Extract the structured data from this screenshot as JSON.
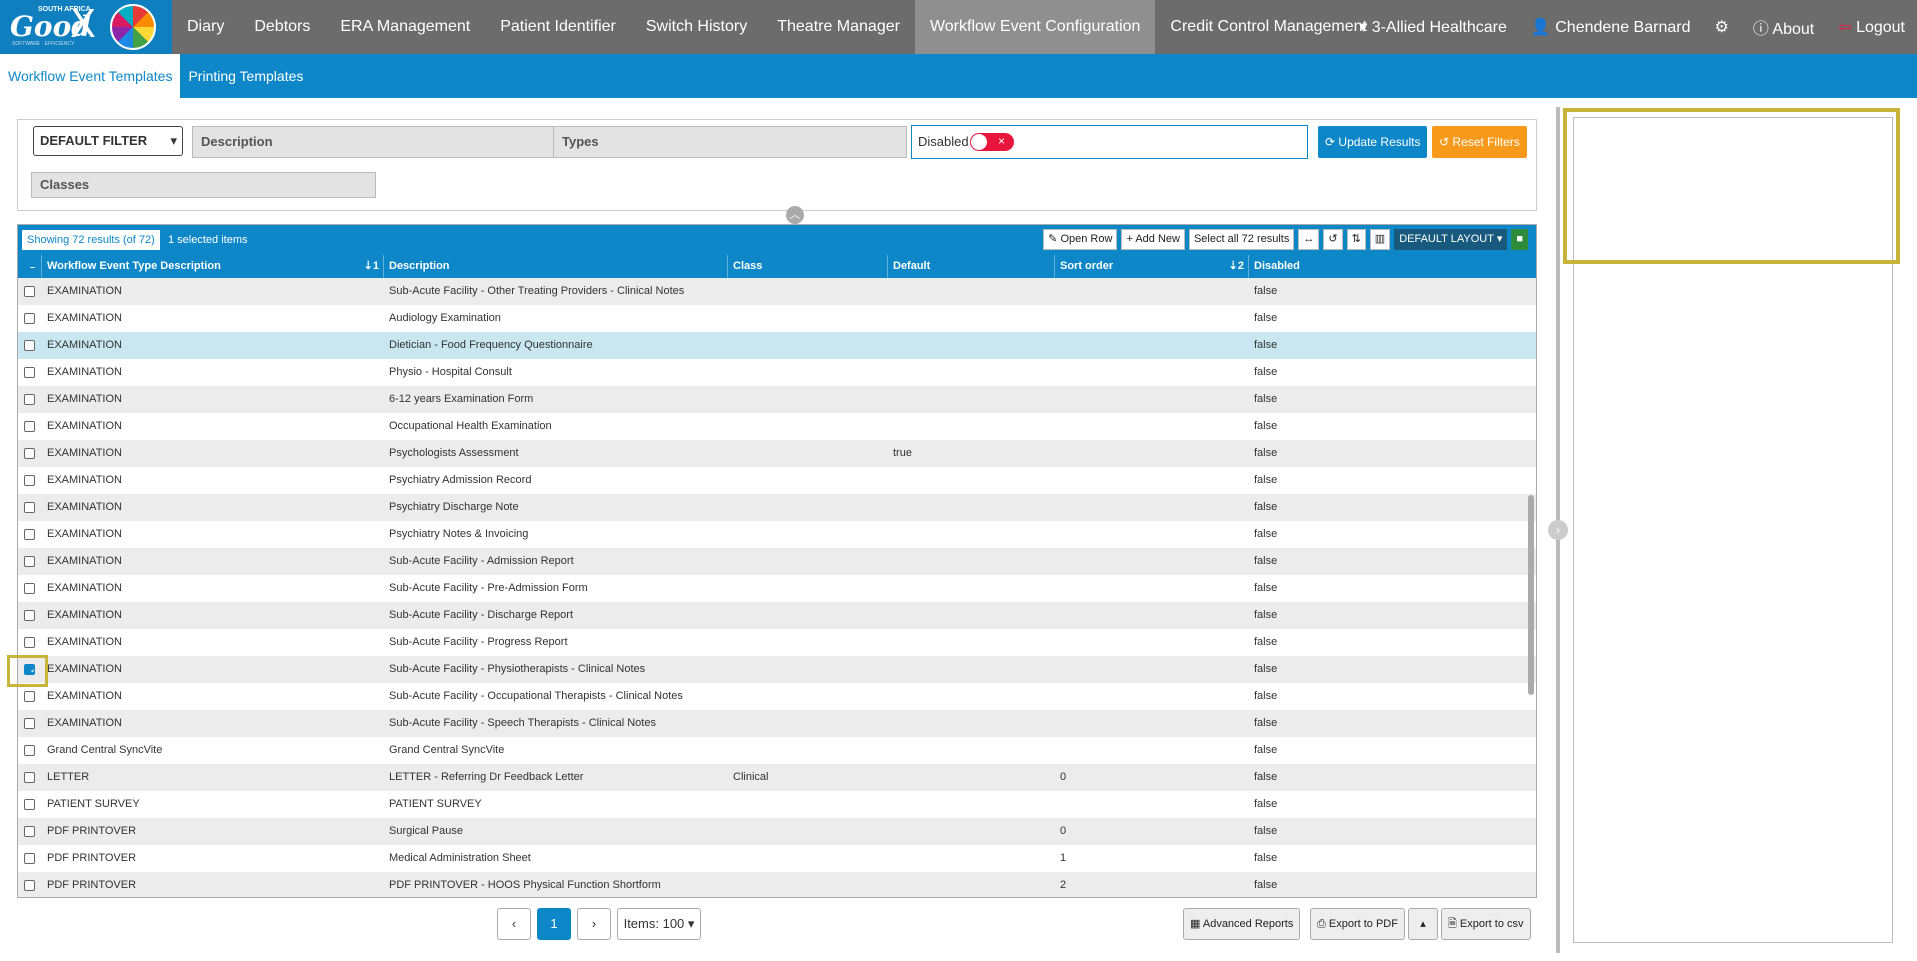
{
  "brand": {
    "good": "Good",
    "sa": "SOUTH AFRICA",
    "x": "X",
    "tagline": "SOFTWARE · EFFICIENCY"
  },
  "nav": [
    "Diary",
    "Debtors",
    "ERA Management",
    "Patient Identifier",
    "Switch History",
    "Theatre Manager",
    "Workflow Event Configuration",
    "Credit Control Management"
  ],
  "nav_active": "Workflow Event Configuration",
  "rightnav": {
    "practice": "3-Allied Healthcare",
    "user": "Chendene Barnard",
    "about": "About",
    "logout": "Logout"
  },
  "subnav": [
    "Workflow Event Templates",
    "Printing Templates"
  ],
  "filters": {
    "default_filter": "DEFAULT FILTER",
    "description": "Description",
    "types": "Types",
    "disabled": "Disabled",
    "classes": "Classes",
    "update": "Update Results",
    "reset": "Reset Filters"
  },
  "grid": {
    "count": "Showing 72 results (of 72)",
    "selected": "1 selected items",
    "tools": {
      "open": "Open Row",
      "add": "Add New",
      "select_all": "Select all 72 results",
      "layout": "DEFAULT LAYOUT"
    },
    "columns": [
      "Workflow Event Type Description",
      "Description",
      "Class",
      "Default",
      "Sort order",
      "Disabled"
    ],
    "sort1": "1",
    "sort2": "2",
    "rows": [
      [
        "EXAMINATION",
        "Sub-Acute Facility - Other Treating Providers - Clinical Notes",
        "",
        "",
        "",
        "false"
      ],
      [
        "EXAMINATION",
        "Audiology Examination",
        "",
        "",
        "",
        "false"
      ],
      [
        "EXAMINATION",
        "Dietician - Food Frequency Questionnaire",
        "",
        "",
        "",
        "false"
      ],
      [
        "EXAMINATION",
        "Physio - Hospital Consult",
        "",
        "",
        "",
        "false"
      ],
      [
        "EXAMINATION",
        "6-12 years Examination Form",
        "",
        "",
        "",
        "false"
      ],
      [
        "EXAMINATION",
        "Occupational Health Examination",
        "",
        "",
        "",
        "false"
      ],
      [
        "EXAMINATION",
        "Psychologists Assessment",
        "",
        "true",
        "",
        "false"
      ],
      [
        "EXAMINATION",
        "Psychiatry Admission Record",
        "",
        "",
        "",
        "false"
      ],
      [
        "EXAMINATION",
        "Psychiatry Discharge Note",
        "",
        "",
        "",
        "false"
      ],
      [
        "EXAMINATION",
        "Psychiatry Notes & Invoicing",
        "",
        "",
        "",
        "false"
      ],
      [
        "EXAMINATION",
        "Sub-Acute Facility - Admission Report",
        "",
        "",
        "",
        "false"
      ],
      [
        "EXAMINATION",
        "Sub-Acute Facility - Pre-Admission Form",
        "",
        "",
        "",
        "false"
      ],
      [
        "EXAMINATION",
        "Sub-Acute Facility - Discharge Report",
        "",
        "",
        "",
        "false"
      ],
      [
        "EXAMINATION",
        "Sub-Acute Facility - Progress Report",
        "",
        "",
        "",
        "false"
      ],
      [
        "EXAMINATION",
        "Sub-Acute Facility - Physiotherapists - Clinical Notes",
        "",
        "",
        "",
        "false"
      ],
      [
        "EXAMINATION",
        "Sub-Acute Facility - Occupational Therapists - Clinical Notes",
        "",
        "",
        "",
        "false"
      ],
      [
        "EXAMINATION",
        "Sub-Acute Facility - Speech Therapists - Clinical Notes",
        "",
        "",
        "",
        "false"
      ],
      [
        "Grand Central SyncVite",
        "Grand Central SyncVite",
        "",
        "",
        "",
        "false"
      ],
      [
        "LETTER",
        "LETTER - Referring Dr Feedback Letter",
        "Clinical",
        "",
        "0",
        "false"
      ],
      [
        "PATIENT SURVEY",
        "PATIENT SURVEY",
        "",
        "",
        "",
        "false"
      ],
      [
        "PDF PRINTOVER",
        "Surgical Pause",
        "",
        "",
        "0",
        "false"
      ],
      [
        "PDF PRINTOVER",
        "Medical Administration Sheet",
        "",
        "",
        "1",
        "false"
      ],
      [
        "PDF PRINTOVER",
        "PDF PRINTOVER - HOOS Physical Function Shortform",
        "",
        "",
        "2",
        "false"
      ]
    ],
    "checked_row": 14,
    "highlight_row": 2
  },
  "pager": {
    "prev": "‹",
    "page": "1",
    "next": "›",
    "items": "Items: 100"
  },
  "bottom": {
    "advanced": "Advanced Reports",
    "pdf": "Export to PDF",
    "csv": "Export to csv"
  }
}
